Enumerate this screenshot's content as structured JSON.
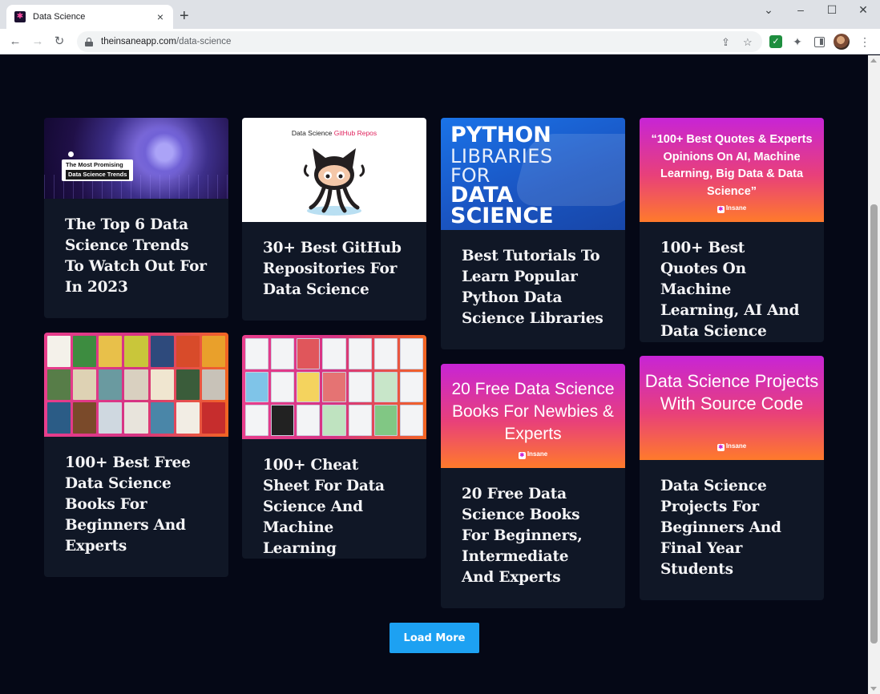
{
  "browser": {
    "tab_title": "Data Science",
    "new_tab": "+",
    "close_tab": "×",
    "url_host": "theinsaneapp.com",
    "url_path": "/data-science"
  },
  "cards": [
    {
      "title": "The Top 6 Data Science Trends To Watch Out For In 2023",
      "image_text": [
        "The Most Promising",
        "Data Science Trends"
      ]
    },
    {
      "title": "30+ Best GitHub Repositories For Data Science",
      "image_text": [
        "Data Science ",
        "GitHub Repos"
      ]
    },
    {
      "title": "Best Tutorials To Learn Popular Python Data Science Libraries",
      "image_text": [
        "PYTHON",
        "LIBRARIES",
        "FOR",
        "DATA",
        "SCIENCE"
      ]
    },
    {
      "title": "100+ Best Quotes On Machine Learning, AI And Data Science",
      "image_text": [
        "“100+ Best Quotes & Experts Opinions On AI, Machine Learning, Big Data & Data Science”"
      ],
      "brand": "Insane"
    },
    {
      "title": "100+ Best Free Data Science Books For Beginners And Experts",
      "image_text": []
    },
    {
      "title": "100+ Cheat Sheet For Data Science And Machine Learning",
      "image_text": []
    },
    {
      "title": "20 Free Data Science Books For Beginners, Intermediate And Experts",
      "image_text": [
        "20 Free Data Science Books For Newbies & Experts"
      ],
      "brand": "Insane"
    },
    {
      "title": "Data Science Projects For Beginners And Final Year Students",
      "image_text": [
        "Data Science Projects With Source Code"
      ],
      "brand": "Insane"
    }
  ],
  "load_more_label": "Load More",
  "colors": {
    "page_bg": "#050816",
    "card_bg": "#101726",
    "button": "#1da1f2"
  }
}
